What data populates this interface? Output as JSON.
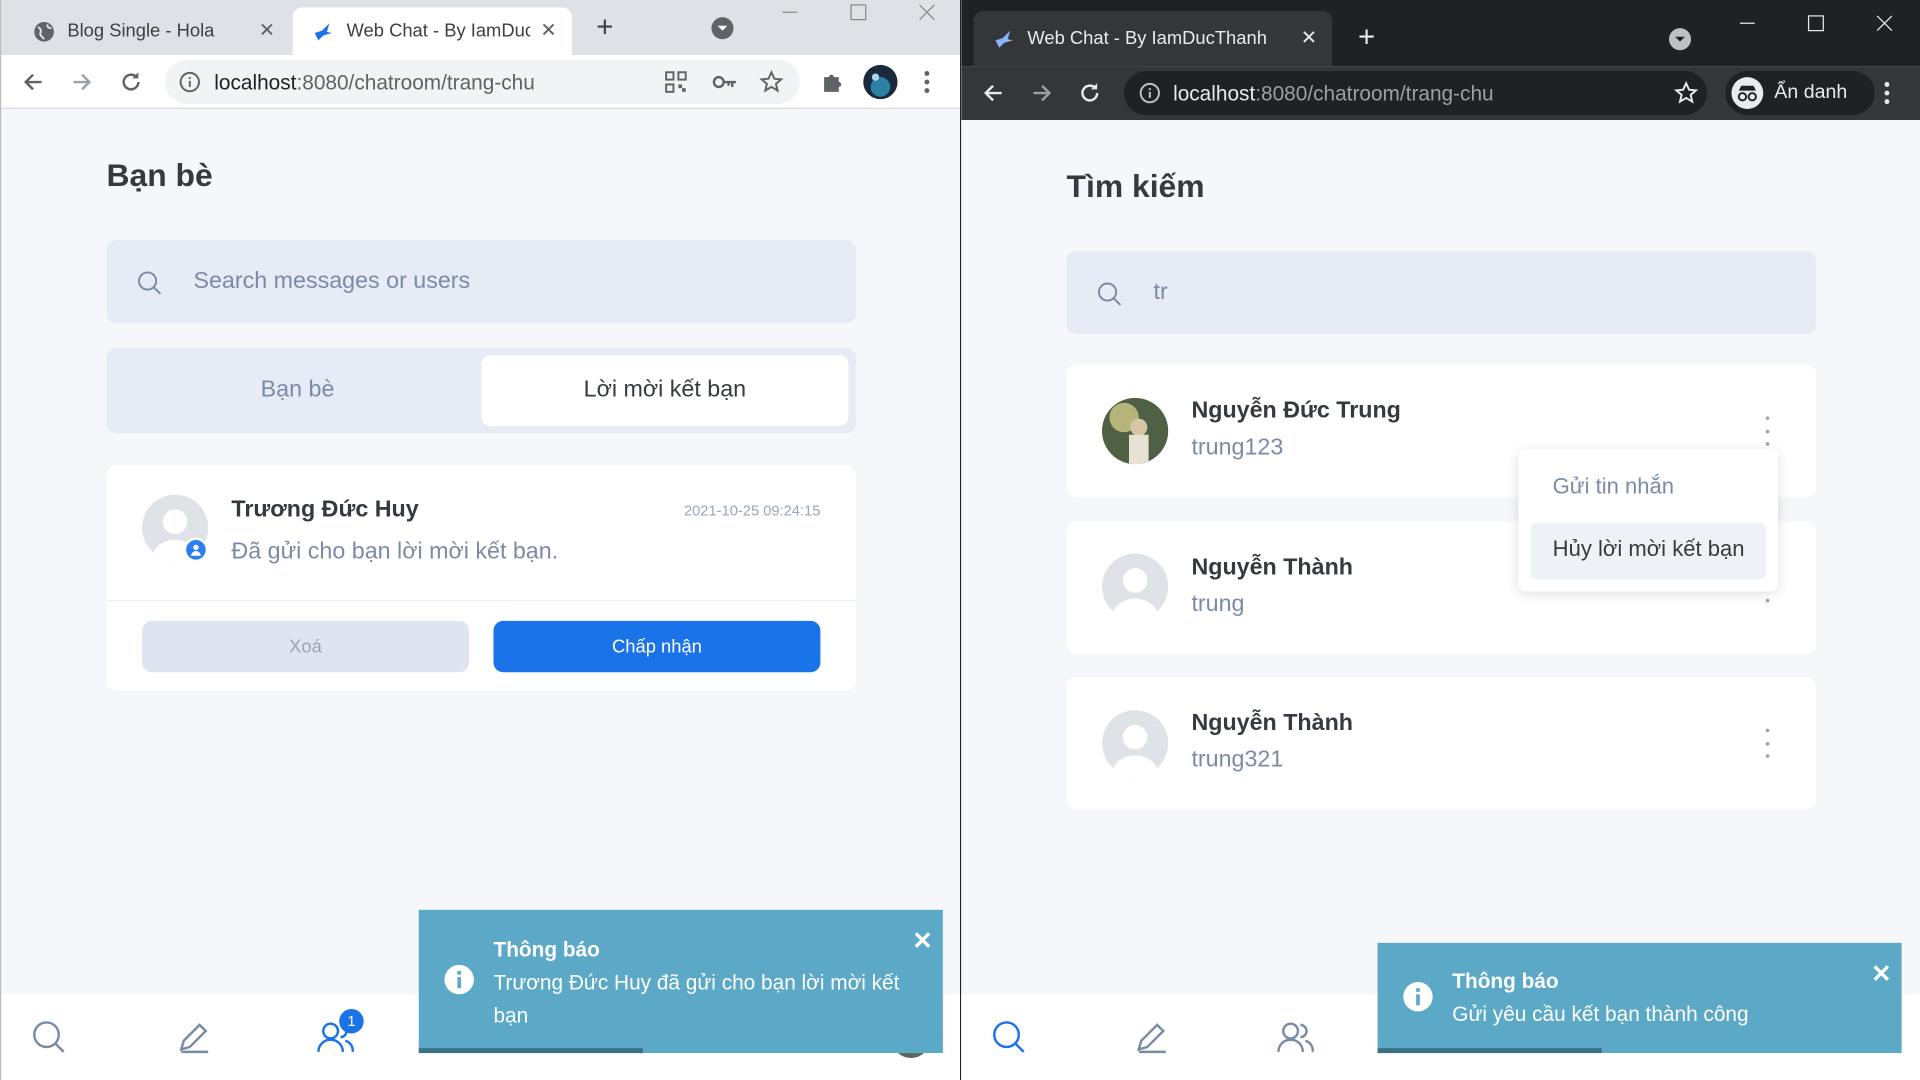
{
  "left": {
    "tabs": [
      {
        "title": "Blog Single - Hola",
        "active": false
      },
      {
        "title": "Web Chat - By IamDuc",
        "active": true
      }
    ],
    "url_host": "localhost",
    "url_path": ":8080/chatroom/trang-chu",
    "page_title": "Bạn bè",
    "search_placeholder": "Search messages or users",
    "segment_tabs": [
      "Bạn bè",
      "Lời mời kết bạn"
    ],
    "request": {
      "name": "Trương Đức Huy",
      "message": "Đã gửi cho bạn lời mời kết bạn.",
      "time": "2021-10-25 09:24:15",
      "delete_label": "Xoá",
      "accept_label": "Chấp nhận"
    },
    "friends_badge": "1",
    "toast": {
      "title": "Thông báo",
      "message": "Trương Đức Huy đã gửi cho bạn lời mời kết bạn"
    }
  },
  "right": {
    "tab_title": "Web Chat - By IamDucThanh",
    "url_host": "localhost",
    "url_path": ":8080/chatroom/trang-chu",
    "incognito_label": "Ẩn danh",
    "page_title": "Tìm kiếm",
    "search_value": "tr",
    "results": [
      {
        "name": "Nguyễn Đức Trung",
        "username": "trung123"
      },
      {
        "name": "Nguyễn Thành",
        "username": "trung"
      },
      {
        "name": "Nguyễn Thành",
        "username": "trung321"
      }
    ],
    "menu": [
      "Gửi tin nhắn",
      "Hủy lời mời kết bạn"
    ],
    "toast": {
      "title": "Thông báo",
      "message": "Gửi yêu cầu kết bạn thành công"
    }
  },
  "colors": {
    "primary": "#1a73e8",
    "accent_blue": "#2a7ff3",
    "toast": "#5ba9c6",
    "muted_text": "#7a8ba6",
    "bg": "#f5f7fb"
  }
}
